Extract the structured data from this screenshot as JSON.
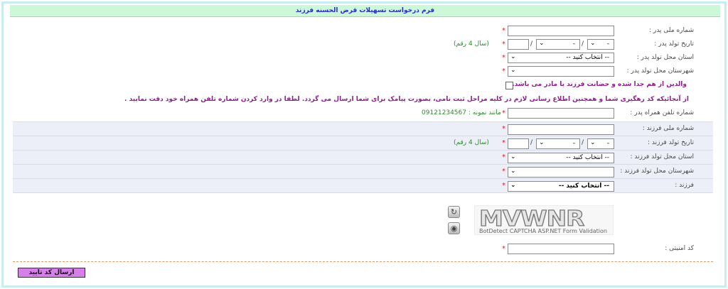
{
  "header": {
    "title": "فرم درخواست تسهیلات قرض الحسنه فرزند"
  },
  "father": {
    "national_id_label": "شماره ملی پدر :",
    "birth_date_label": "تاریخ تولد پدر :",
    "birth_province_label": "استان محل تولد پدر :",
    "birth_city_label": "شهرستان محل تولد پدر :",
    "year_hint": "(سال 4 رقم)",
    "day_value": "-",
    "month_value": "-",
    "province_value": "-- انتخاب کنید --",
    "date_separator": "/"
  },
  "custody": {
    "label": "والدین از هم جدا شده و حضانت فرزند با مادر می باشد."
  },
  "notice": {
    "text": "از آنجائیکه کد رهگیری شما و همچنین اطلاع رسانی لازم در کلیه مراحل ثبت نامی، بصورت پیامک برای شما ارسال می گردد. لطفا در وارد کردن شماره تلفن همراه خود دقت نمایید ."
  },
  "mobile": {
    "label": "شماره تلفن همراه پدر :",
    "hint": "مانند نمونه : 09121234567"
  },
  "child": {
    "national_id_label": "شماره ملی فرزند :",
    "birth_date_label": "تاریخ تولد فرزند :",
    "birth_province_label": "استان محل تولد فرزند :",
    "birth_city_label": "شهرستان محل تولد فرزند :",
    "child_label": "فرزند :",
    "year_hint": "(سال 4 رقم)",
    "day_value": "-",
    "month_value": "-",
    "province_value": "-- انتخاب کنید --",
    "child_value": "-- انتخاب کنید --",
    "date_separator": "/"
  },
  "captcha": {
    "word": "MVWNR",
    "caption": "BotDetect CAPTCHA ASP.NET Form Validation",
    "security_code_label": "کد امنیتی :"
  },
  "required_mark": "*",
  "submit": {
    "label": "ارسال کد تایید"
  },
  "colors": {
    "header_bg": "#ccf7d9",
    "required": "#d0202a",
    "hint": "#2e8a2e",
    "notice": "#8b1e8b",
    "submit_bg": "#d580e8"
  }
}
